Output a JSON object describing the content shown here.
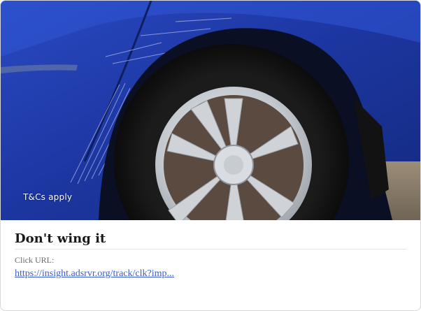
{
  "ad": {
    "image_alt": "Close-up of a scratched blue car's rear wheel and alloy rim",
    "overlay_text": "T&Cs apply",
    "headline": "Don't wing it",
    "click_url_label": "Click URL:",
    "click_url_text": "https://insight.adsrvr.org/track/clk?imp..."
  },
  "colors": {
    "link": "#3b5cc6",
    "car_body": "#1f3aa6",
    "headline": "#1a1a1a"
  }
}
